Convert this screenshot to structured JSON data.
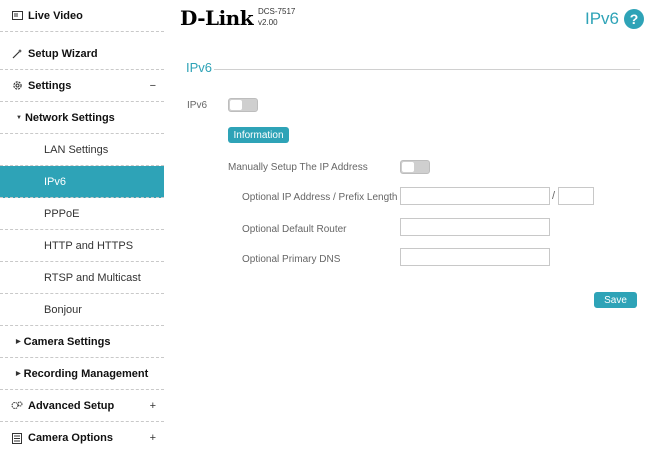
{
  "sidebar": {
    "live_video": "Live Video",
    "setup_wizard": "Setup Wizard",
    "settings": "Settings",
    "settings_toggle": "−",
    "network_settings": "Network Settings",
    "lan_settings": "LAN Settings",
    "ipv6": "IPv6",
    "pppoe": "PPPoE",
    "http_https": "HTTP and HTTPS",
    "rtsp_multicast": "RTSP and Multicast",
    "bonjour": "Bonjour",
    "camera_settings": "Camera Settings",
    "recording_management": "Recording Management",
    "advanced_setup": "Advanced Setup",
    "advanced_setup_toggle": "+",
    "camera_options": "Camera Options",
    "camera_options_toggle": "+"
  },
  "header": {
    "logo": "D-Link",
    "model": "DCS-7517",
    "version": "v2.00",
    "page_title": "IPv6",
    "help": "?"
  },
  "main": {
    "section_title": "IPv6",
    "ipv6_label": "IPv6",
    "ipv6_enabled": false,
    "information_button": "Information",
    "manual_label": "Manually Setup The IP Address",
    "manual_enabled": false,
    "ip_prefix_label": "Optional IP Address / Prefix Length",
    "ip_value": "",
    "prefix_separator": "/",
    "prefix_value": "",
    "router_label": "Optional Default Router",
    "router_value": "",
    "dns_label": "Optional Primary DNS",
    "dns_value": "",
    "save_button": "Save"
  },
  "colors": {
    "accent": "#2ea3b7"
  }
}
